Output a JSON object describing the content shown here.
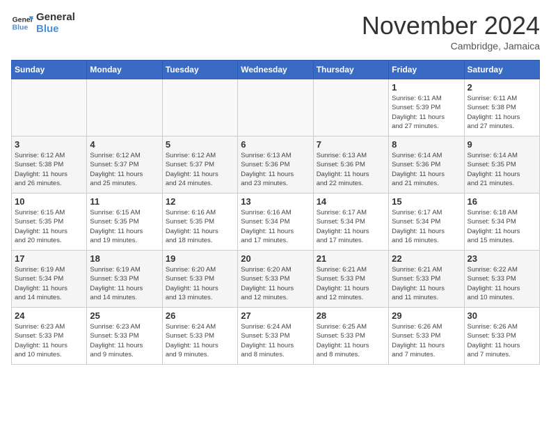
{
  "logo": {
    "line1": "General",
    "line2": "Blue"
  },
  "title": "November 2024",
  "subtitle": "Cambridge, Jamaica",
  "days_header": [
    "Sunday",
    "Monday",
    "Tuesday",
    "Wednesday",
    "Thursday",
    "Friday",
    "Saturday"
  ],
  "weeks": [
    [
      {
        "day": "",
        "info": ""
      },
      {
        "day": "",
        "info": ""
      },
      {
        "day": "",
        "info": ""
      },
      {
        "day": "",
        "info": ""
      },
      {
        "day": "",
        "info": ""
      },
      {
        "day": "1",
        "info": "Sunrise: 6:11 AM\nSunset: 5:39 PM\nDaylight: 11 hours\nand 27 minutes."
      },
      {
        "day": "2",
        "info": "Sunrise: 6:11 AM\nSunset: 5:38 PM\nDaylight: 11 hours\nand 27 minutes."
      }
    ],
    [
      {
        "day": "3",
        "info": "Sunrise: 6:12 AM\nSunset: 5:38 PM\nDaylight: 11 hours\nand 26 minutes."
      },
      {
        "day": "4",
        "info": "Sunrise: 6:12 AM\nSunset: 5:37 PM\nDaylight: 11 hours\nand 25 minutes."
      },
      {
        "day": "5",
        "info": "Sunrise: 6:12 AM\nSunset: 5:37 PM\nDaylight: 11 hours\nand 24 minutes."
      },
      {
        "day": "6",
        "info": "Sunrise: 6:13 AM\nSunset: 5:36 PM\nDaylight: 11 hours\nand 23 minutes."
      },
      {
        "day": "7",
        "info": "Sunrise: 6:13 AM\nSunset: 5:36 PM\nDaylight: 11 hours\nand 22 minutes."
      },
      {
        "day": "8",
        "info": "Sunrise: 6:14 AM\nSunset: 5:36 PM\nDaylight: 11 hours\nand 21 minutes."
      },
      {
        "day": "9",
        "info": "Sunrise: 6:14 AM\nSunset: 5:35 PM\nDaylight: 11 hours\nand 21 minutes."
      }
    ],
    [
      {
        "day": "10",
        "info": "Sunrise: 6:15 AM\nSunset: 5:35 PM\nDaylight: 11 hours\nand 20 minutes."
      },
      {
        "day": "11",
        "info": "Sunrise: 6:15 AM\nSunset: 5:35 PM\nDaylight: 11 hours\nand 19 minutes."
      },
      {
        "day": "12",
        "info": "Sunrise: 6:16 AM\nSunset: 5:35 PM\nDaylight: 11 hours\nand 18 minutes."
      },
      {
        "day": "13",
        "info": "Sunrise: 6:16 AM\nSunset: 5:34 PM\nDaylight: 11 hours\nand 17 minutes."
      },
      {
        "day": "14",
        "info": "Sunrise: 6:17 AM\nSunset: 5:34 PM\nDaylight: 11 hours\nand 17 minutes."
      },
      {
        "day": "15",
        "info": "Sunrise: 6:17 AM\nSunset: 5:34 PM\nDaylight: 11 hours\nand 16 minutes."
      },
      {
        "day": "16",
        "info": "Sunrise: 6:18 AM\nSunset: 5:34 PM\nDaylight: 11 hours\nand 15 minutes."
      }
    ],
    [
      {
        "day": "17",
        "info": "Sunrise: 6:19 AM\nSunset: 5:34 PM\nDaylight: 11 hours\nand 14 minutes."
      },
      {
        "day": "18",
        "info": "Sunrise: 6:19 AM\nSunset: 5:33 PM\nDaylight: 11 hours\nand 14 minutes."
      },
      {
        "day": "19",
        "info": "Sunrise: 6:20 AM\nSunset: 5:33 PM\nDaylight: 11 hours\nand 13 minutes."
      },
      {
        "day": "20",
        "info": "Sunrise: 6:20 AM\nSunset: 5:33 PM\nDaylight: 11 hours\nand 12 minutes."
      },
      {
        "day": "21",
        "info": "Sunrise: 6:21 AM\nSunset: 5:33 PM\nDaylight: 11 hours\nand 12 minutes."
      },
      {
        "day": "22",
        "info": "Sunrise: 6:21 AM\nSunset: 5:33 PM\nDaylight: 11 hours\nand 11 minutes."
      },
      {
        "day": "23",
        "info": "Sunrise: 6:22 AM\nSunset: 5:33 PM\nDaylight: 11 hours\nand 10 minutes."
      }
    ],
    [
      {
        "day": "24",
        "info": "Sunrise: 6:23 AM\nSunset: 5:33 PM\nDaylight: 11 hours\nand 10 minutes."
      },
      {
        "day": "25",
        "info": "Sunrise: 6:23 AM\nSunset: 5:33 PM\nDaylight: 11 hours\nand 9 minutes."
      },
      {
        "day": "26",
        "info": "Sunrise: 6:24 AM\nSunset: 5:33 PM\nDaylight: 11 hours\nand 9 minutes."
      },
      {
        "day": "27",
        "info": "Sunrise: 6:24 AM\nSunset: 5:33 PM\nDaylight: 11 hours\nand 8 minutes."
      },
      {
        "day": "28",
        "info": "Sunrise: 6:25 AM\nSunset: 5:33 PM\nDaylight: 11 hours\nand 8 minutes."
      },
      {
        "day": "29",
        "info": "Sunrise: 6:26 AM\nSunset: 5:33 PM\nDaylight: 11 hours\nand 7 minutes."
      },
      {
        "day": "30",
        "info": "Sunrise: 6:26 AM\nSunset: 5:33 PM\nDaylight: 11 hours\nand 7 minutes."
      }
    ]
  ]
}
